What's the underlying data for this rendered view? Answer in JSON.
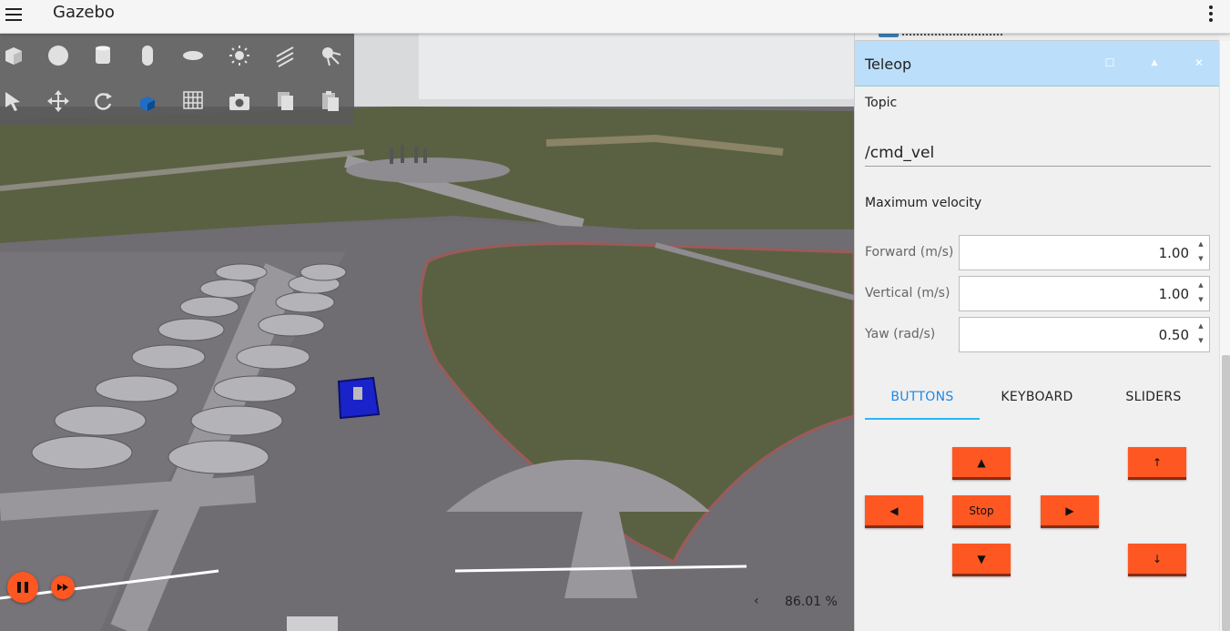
{
  "app": {
    "title": "Gazebo"
  },
  "toolbar": {
    "row1": [
      "box-icon",
      "sphere-icon",
      "cylinder-icon",
      "capsule-icon",
      "ellipsoid-icon",
      "sun-light-icon",
      "directional-light-icon",
      "spot-light-icon"
    ],
    "row2": [
      "select-arrow-icon",
      "translate-icon",
      "rotate-icon",
      "insert-model-icon",
      "grid-icon",
      "camera-icon",
      "copy-icon",
      "paste-icon"
    ]
  },
  "playback": {
    "play_icon": "pause-icon",
    "step_icon": "fast-forward-icon",
    "rtf_chevron": "‹",
    "rtf": "86.01 %"
  },
  "teleop": {
    "title": "Teleop",
    "topic_label": "Topic",
    "topic_value": "/cmd_vel",
    "max_velocity_label": "Maximum velocity",
    "forward": {
      "label": "Forward (m/s)",
      "value": "1.00"
    },
    "vertical": {
      "label": "Vertical (m/s)",
      "value": "1.00"
    },
    "yaw": {
      "label": "Yaw (rad/s)",
      "value": "0.50"
    },
    "tabs": [
      "BUTTONS",
      "KEYBOARD",
      "SLIDERS"
    ],
    "active_tab": "BUTTONS",
    "buttons": {
      "forward": "▲",
      "left": "◀",
      "stop": "Stop",
      "right": "▶",
      "backward": "▼",
      "up": "↑",
      "down": "↓"
    }
  },
  "colors": {
    "accent": "#ff5722",
    "header_bg": "#bbdefb",
    "tab_active": "#1e88e5"
  }
}
